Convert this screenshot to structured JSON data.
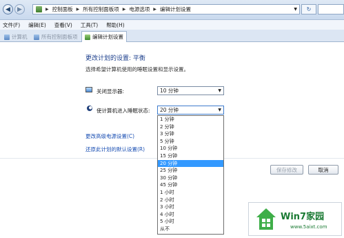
{
  "address_bar": {
    "breadcrumbs": [
      "控制面板",
      "所有控制面板项",
      "电源选项",
      "编辑计划设置"
    ],
    "refresh_glyph": "↻"
  },
  "menu": [
    "文件(F)",
    "编辑(E)",
    "查看(V)",
    "工具(T)",
    "帮助(H)"
  ],
  "tabs": [
    {
      "label": "计算机",
      "active": false
    },
    {
      "label": "所有控制面板项",
      "active": false
    },
    {
      "label": "编辑计划设置",
      "active": true
    }
  ],
  "main": {
    "title": "更改计划的设置: 平衡",
    "subtitle": "选择希望计算机使用的睡眠设置和显示设置。",
    "display_off": {
      "label": "关闭显示器:",
      "value": "10 分钟",
      "icon": "monitor-icon"
    },
    "sleep": {
      "label": "使计算机进入睡眠状态:",
      "value": "20 分钟",
      "icon": "moon-icon"
    },
    "links": {
      "advanced": "更改高级电源设置(C)",
      "restore": "还原此计划的默认设置(R)"
    },
    "buttons": {
      "save": "保存修改",
      "cancel": "取消"
    }
  },
  "dropdown": {
    "options": [
      "1 分钟",
      "2 分钟",
      "3 分钟",
      "5 分钟",
      "10 分钟",
      "15 分钟",
      "20 分钟",
      "25 分钟",
      "30 分钟",
      "45 分钟",
      "1 小时",
      "2 小时",
      "3 小时",
      "4 小时",
      "5 小时",
      "从不"
    ],
    "selected_index": 6
  },
  "watermark": {
    "brand": "Win7家园",
    "url": "www.5aixt.com"
  },
  "colors": {
    "title_blue": "#1c3f8c",
    "link_blue": "#1a4fb3",
    "selection": "#3399ff",
    "brand_green": "#1a7a33"
  }
}
